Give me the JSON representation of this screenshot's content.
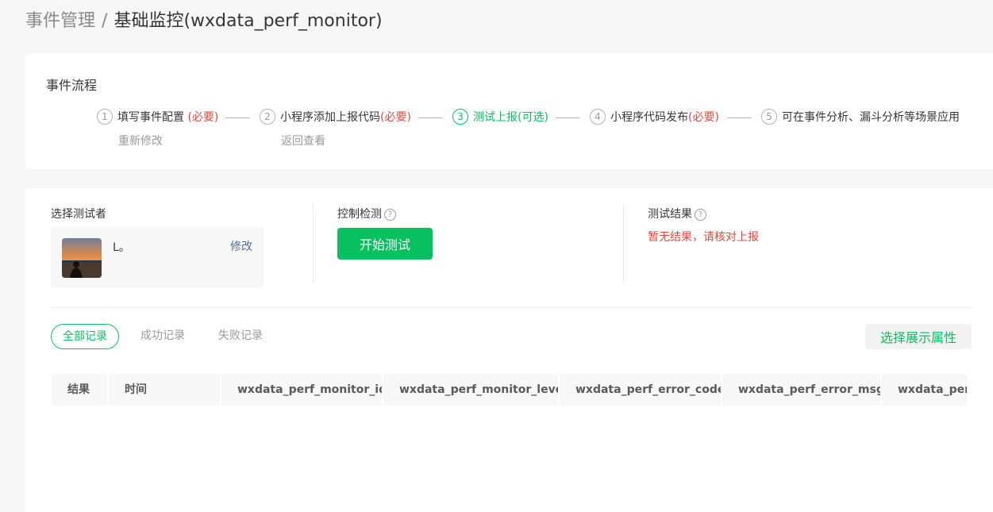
{
  "breadcrumb": {
    "parent": "事件管理",
    "separator": "/",
    "current": "基础监控(wxdata_perf_monitor)"
  },
  "flow": {
    "title": "事件流程",
    "steps": [
      {
        "num": "1",
        "label": "填写事件配置 ",
        "required": "(必要)",
        "sub": "重新修改",
        "active": false
      },
      {
        "num": "2",
        "label": "小程序添加上报代码",
        "required": "(必要)",
        "sub": "返回查看",
        "active": false
      },
      {
        "num": "3",
        "label": "测试上报",
        "required": "(可选)",
        "sub": "",
        "active": true
      },
      {
        "num": "4",
        "label": "小程序代码发布",
        "required": "(必要)",
        "sub": "",
        "active": false
      },
      {
        "num": "5",
        "label": "可在事件分析、漏斗分析等场景应用",
        "required": "",
        "sub": "",
        "active": false
      }
    ]
  },
  "tester": {
    "label": "选择测试者",
    "name": "L。",
    "edit_label": "修改"
  },
  "control": {
    "label": "控制检测",
    "help": "?",
    "start_button": "开始测试"
  },
  "result": {
    "label": "测试结果",
    "help": "?",
    "message": "暂无结果，请核对上报"
  },
  "tabs": [
    "全部记录",
    "成功记录",
    "失败记录"
  ],
  "attr_button": "选择展示属性",
  "table": {
    "columns": [
      "结果",
      "时间",
      "wxdata_perf_monitor_id",
      "wxdata_perf_monitor_level",
      "wxdata_perf_error_code",
      "wxdata_perf_error_msg",
      "wxdata_perf_"
    ]
  },
  "colors": {
    "accent": "#07c160",
    "required": "#e0483e",
    "link": "#576b95"
  }
}
